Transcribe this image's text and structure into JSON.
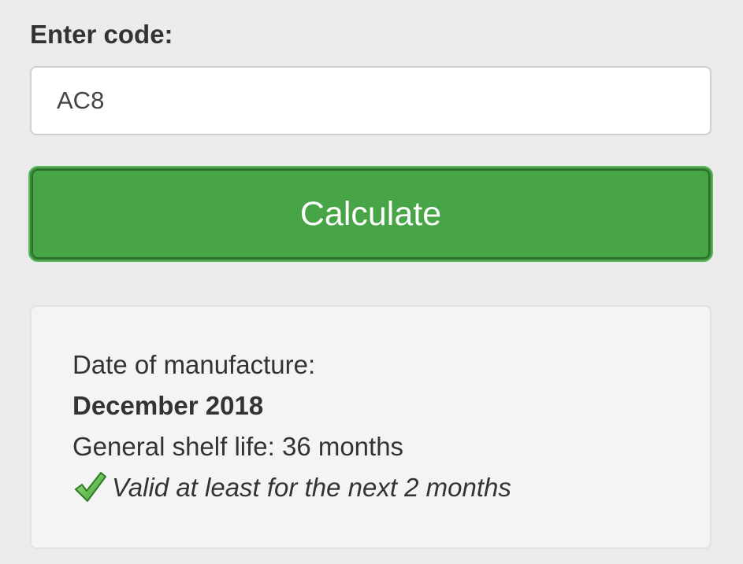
{
  "form": {
    "label": "Enter code:",
    "code_value": "AC8",
    "calculate_label": "Calculate"
  },
  "result": {
    "manufacture_label": "Date of manufacture:",
    "manufacture_date": "December 2018",
    "shelf_life": "General shelf life: 36 months",
    "validity": "Valid at least for the next 2 months",
    "validity_icon": "checkmark-icon"
  },
  "colors": {
    "button_green": "#47a447",
    "check_green": "#5cb85c",
    "background": "#ebebeb",
    "panel": "#f4f4f4"
  }
}
